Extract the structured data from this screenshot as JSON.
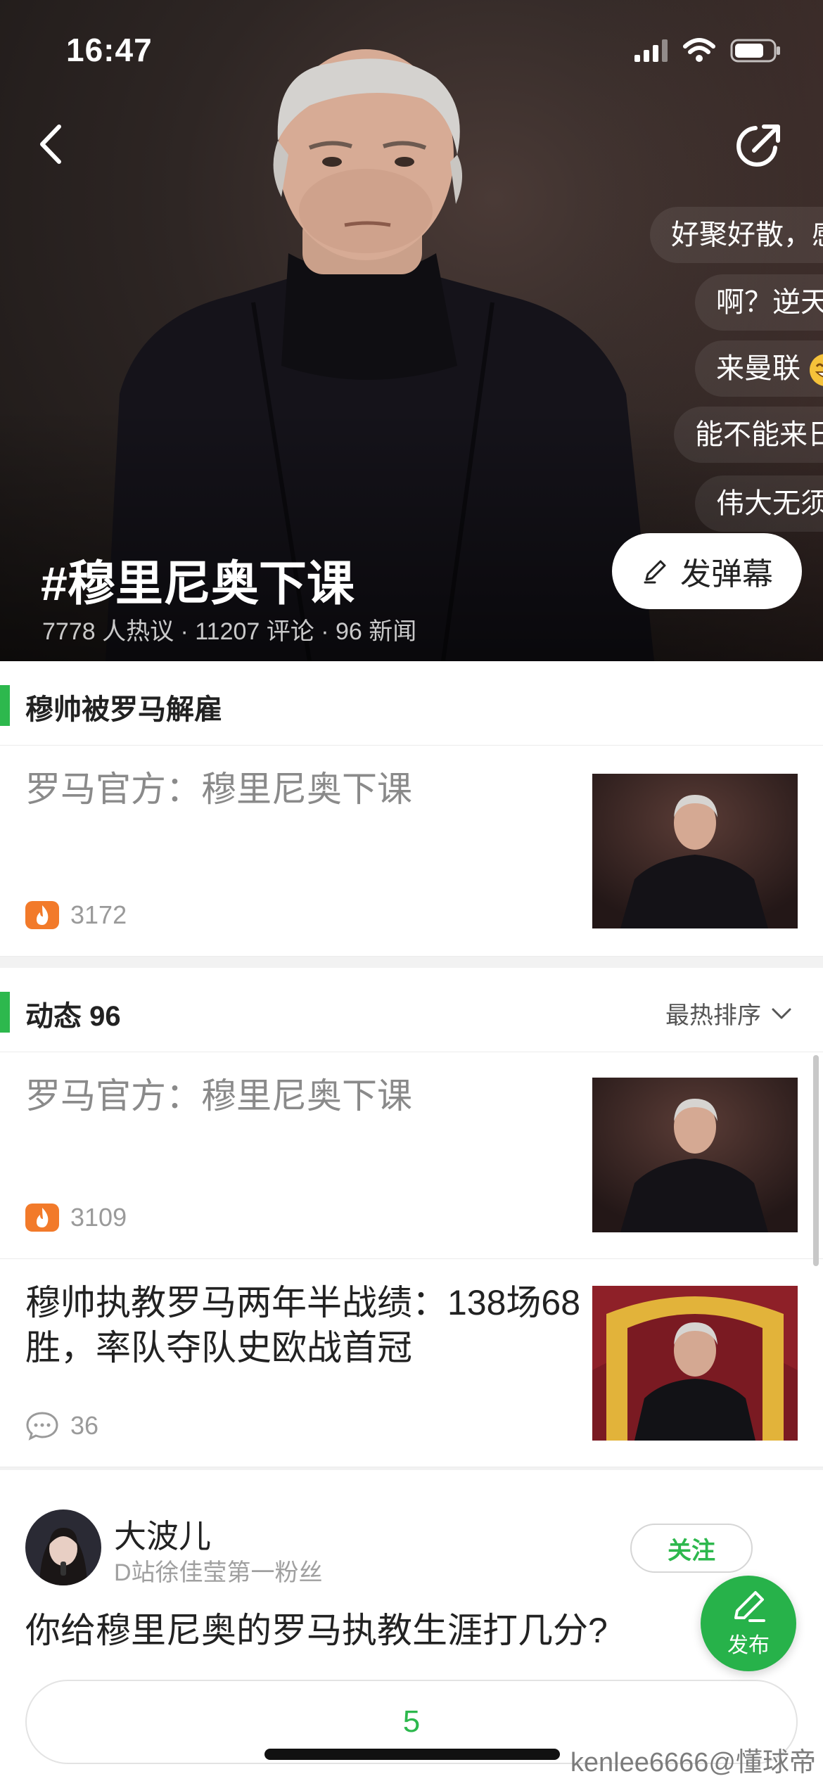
{
  "status_bar": {
    "time": "16:47"
  },
  "hero": {
    "title": "#穆里尼奥下课",
    "stats": "7778 人热议 · 11207 评论 · 96 新闻",
    "danmaku": [
      "好聚好散，感",
      "啊？逆天",
      "来曼联",
      "能不能来日",
      "伟大无须"
    ],
    "danmaku_button": "发弹幕"
  },
  "topic_section": {
    "title": "穆帅被罗马解雇"
  },
  "topic_news": {
    "headline": "罗马官方：穆里尼奥下课",
    "hot_count": "3172"
  },
  "feed_section": {
    "title": "动态 96",
    "sort_label": "最热排序"
  },
  "feed": [
    {
      "headline": "罗马官方：穆里尼奥下课",
      "count": "3109",
      "count_type": "hot"
    },
    {
      "headline": "穆帅执教罗马两年半战绩：138场68胜，率队夺队史欧战首冠",
      "count": "36",
      "count_type": "comment"
    }
  ],
  "post": {
    "user_name": "大波儿",
    "user_subtitle": "D站徐佳莹第一粉丝",
    "follow_label": "关注",
    "question": "你给穆里尼奥的罗马执教生涯打几分?",
    "answer": "5"
  },
  "fab": {
    "label": "发布"
  },
  "watermark": "kenlee6666@懂球帝",
  "colors": {
    "accent": "#2db84d",
    "hot": "#f27a2a"
  }
}
